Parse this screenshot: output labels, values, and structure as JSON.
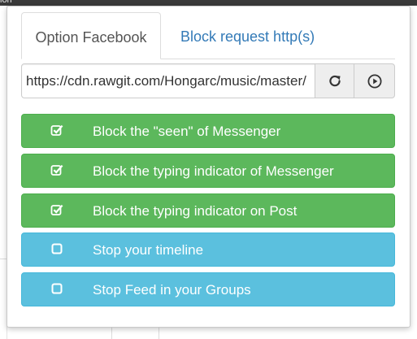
{
  "background": {
    "top_fragment": "ion"
  },
  "tabs": [
    {
      "label": "Option Facebook",
      "active": true
    },
    {
      "label": "Block request http(s)",
      "active": false
    }
  ],
  "url_field": {
    "value": "https://cdn.rawgit.com/Hongarc/music/master/"
  },
  "icons": {
    "reload": "reload-icon",
    "play": "play-circle-icon",
    "checked": "checkbox-checked-icon",
    "unchecked": "checkbox-unchecked-icon"
  },
  "options": [
    {
      "label": "Block the \"seen\" of Messenger",
      "checked": true,
      "color": "#5cb85c"
    },
    {
      "label": "Block the typing indicator of Messenger",
      "checked": true,
      "color": "#5cb85c"
    },
    {
      "label": "Block the typing indicator on Post",
      "checked": true,
      "color": "#5cb85c"
    },
    {
      "label": "Stop your timeline",
      "checked": false,
      "color": "#5bc0de"
    },
    {
      "label": "Stop Feed in your Groups",
      "checked": false,
      "color": "#5bc0de"
    }
  ]
}
